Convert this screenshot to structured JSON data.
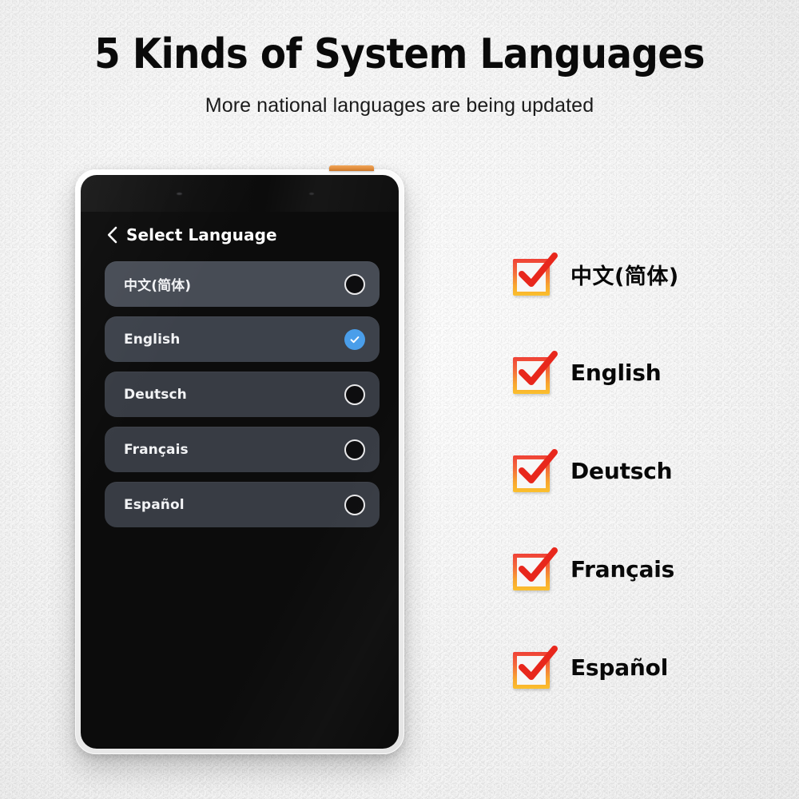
{
  "page": {
    "title": "5 Kinds of System Languages",
    "subtitle": "More national languages are being updated"
  },
  "colors": {
    "background": "#efefef",
    "title_text": "#0a0a0a",
    "tablet_frame": "#ffffff",
    "screen_bg": "#0c0c0c",
    "row_default": "#383c44",
    "row_hovered": "#474c55",
    "selected_accent": "#4a9eea",
    "power_button": "#e08c3c",
    "check_gradient_top": "#ef4136",
    "check_gradient_bottom": "#fbc02d",
    "check_mark": "#e8271c"
  },
  "tablet": {
    "power_button_name": "power-button",
    "camera_name": "front-camera",
    "screen": {
      "header": {
        "back_icon": "chevron-left-icon",
        "title": "Select Language"
      },
      "language_options": [
        {
          "label": "中文(简体)",
          "selected": false,
          "state": "hovered",
          "radio_icon": "radio-unchecked-icon"
        },
        {
          "label": "English",
          "selected": true,
          "state": "selected",
          "radio_icon": "radio-checked-icon"
        },
        {
          "label": "Deutsch",
          "selected": false,
          "state": "default",
          "radio_icon": "radio-unchecked-icon"
        },
        {
          "label": "Français",
          "selected": false,
          "state": "default",
          "radio_icon": "radio-unchecked-icon"
        },
        {
          "label": "Español",
          "selected": false,
          "state": "default",
          "radio_icon": "radio-unchecked-icon"
        }
      ]
    }
  },
  "checklist": {
    "icon": "checkbox-checked-icon",
    "items": [
      {
        "label": "中文(简体)",
        "cjk": true
      },
      {
        "label": "English",
        "cjk": false
      },
      {
        "label": "Deutsch",
        "cjk": false
      },
      {
        "label": "Français",
        "cjk": false
      },
      {
        "label": "Español",
        "cjk": false
      }
    ]
  }
}
